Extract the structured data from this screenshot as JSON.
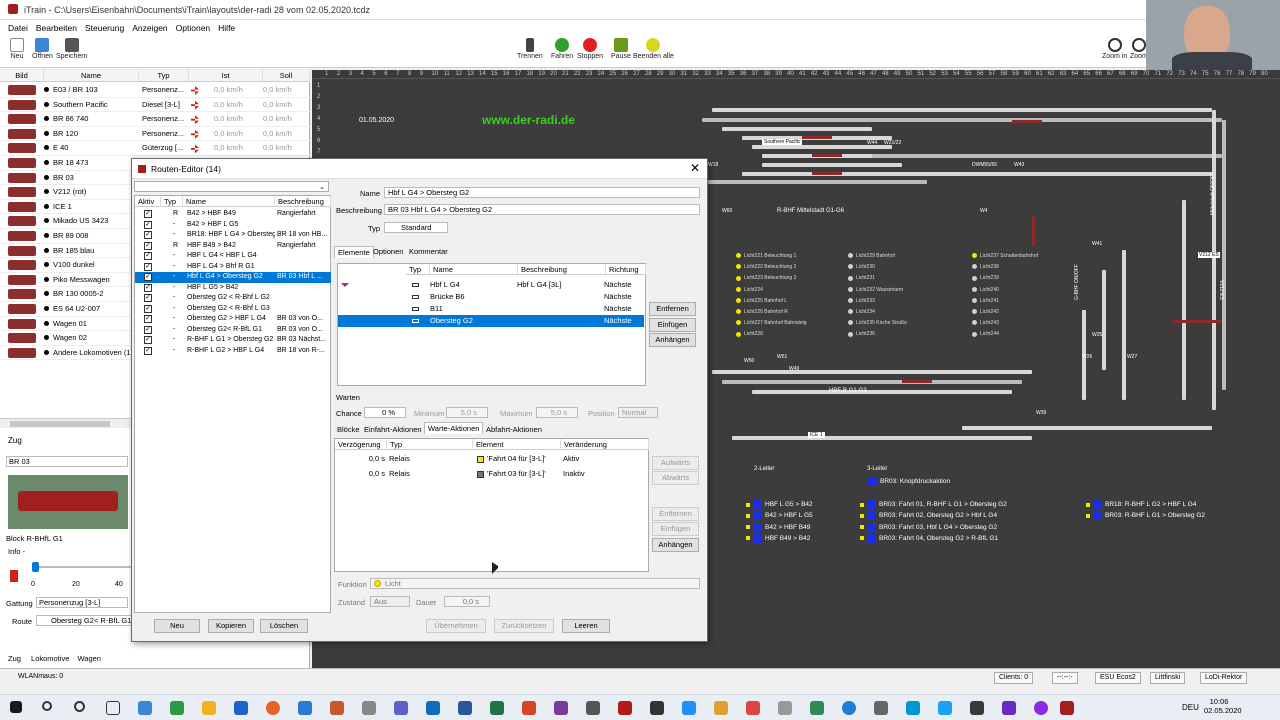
{
  "window": {
    "title": "iTrain - C:\\Users\\Eisenbahn\\Documents\\iTrain\\layouts\\der-radi 28 vom 02.05.2020.tcdz"
  },
  "menu": [
    "Datei",
    "Bearbeiten",
    "Steuerung",
    "Anzeigen",
    "Optionen",
    "Hilfe"
  ],
  "toolbar": {
    "new": "Neu",
    "open": "Öffnen",
    "save": "Speichern",
    "disconnect": "Trennen",
    "run": "Fahren",
    "stop": "Stoppen",
    "pause": "Pause",
    "quit_all": "Beenden alle",
    "zoom_in": "Zoom in",
    "zoom_out": "Zoom"
  },
  "loco_list": {
    "headers": [
      "Bild",
      "Name",
      "Typ",
      "Ist",
      "Soll"
    ],
    "rows": [
      {
        "name": "E03 / BR 103",
        "type": "Personenz...",
        "ist": "0,0 km/h",
        "soll": "0,0 km/h"
      },
      {
        "name": "Southern Pacific",
        "type": "Diesel [3-L]",
        "ist": "0,0 km/h",
        "soll": "0,0 km/h"
      },
      {
        "name": "BR 86 740",
        "type": "Personenz...",
        "ist": "0,0 km/h",
        "soll": "0,0 km/h"
      },
      {
        "name": "BR 120",
        "type": "Personenz...",
        "ist": "0,0 km/h",
        "soll": "0,0 km/h"
      },
      {
        "name": "E 40",
        "type": "Güterzug [...",
        "ist": "0,0 km/h",
        "soll": "0,0 km/h"
      },
      {
        "name": "BR 18 473",
        "type": "",
        "ist": "",
        "soll": ""
      },
      {
        "name": "BR 03",
        "type": "",
        "ist": "",
        "soll": ""
      },
      {
        "name": "V212 (rot)",
        "type": "",
        "ist": "",
        "soll": ""
      },
      {
        "name": "ICE 1",
        "type": "",
        "ist": "",
        "soll": ""
      },
      {
        "name": "Mikado US 3423",
        "type": "",
        "ist": "",
        "soll": ""
      },
      {
        "name": "BR 89 008",
        "type": "",
        "ist": "",
        "soll": ""
      },
      {
        "name": "BR 185 blau",
        "type": "",
        "ist": "",
        "soll": ""
      },
      {
        "name": "V100 dunkel",
        "type": "",
        "ist": "",
        "soll": ""
      },
      {
        "name": "Piko Messwagen",
        "type": "",
        "ist": "",
        "soll": ""
      },
      {
        "name": "BR 130 0005-2",
        "type": "",
        "ist": "",
        "soll": ""
      },
      {
        "name": "ES 64 U2-007",
        "type": "",
        "ist": "",
        "soll": ""
      },
      {
        "name": "Wagen 01",
        "type": "",
        "ist": "",
        "soll": ""
      },
      {
        "name": "Wagen 02",
        "type": "",
        "ist": "",
        "soll": ""
      },
      {
        "name": "Andere Lokomotiven (1)",
        "type": "",
        "ist": "",
        "soll": ""
      }
    ]
  },
  "zug": {
    "label": "Zug",
    "selected": "BR 03",
    "block_label": "Block",
    "block": "R-BHfL G1",
    "info_label": "Info",
    "info": "-",
    "scale": [
      "0",
      "20",
      "40"
    ],
    "speed_fraction": 0.0,
    "gattung_label": "Gattung",
    "gattung": "Personenzug [3-L]",
    "route_label": "Route",
    "route": "Obersteg G2< R-BfL G1"
  },
  "bottom_tabs": [
    "Zug",
    "Lokomotive",
    "Wagen"
  ],
  "wlan": "WLANmaus: 0",
  "dialog": {
    "title": "Routen-Editor (14)",
    "list_headers": [
      "Aktiv",
      "Typ",
      "Name",
      "Beschreibung"
    ],
    "routes": [
      {
        "type": "R",
        "name": "B42 > HBF B49",
        "desc": "Rangierfahrt",
        "sel": false
      },
      {
        "type": "-",
        "name": "B42 > HBF L G5",
        "desc": "",
        "sel": false
      },
      {
        "type": "-",
        "name": "BR18: HBF L G4 > Obersteg G2",
        "desc": "BR 18 von HB...",
        "sel": false
      },
      {
        "type": "R",
        "name": "HBF B49 > B42",
        "desc": "Rangierfahrt",
        "sel": false
      },
      {
        "type": "-",
        "name": "HBF L G4 < HBF L G4",
        "desc": "",
        "sel": false
      },
      {
        "type": "-",
        "name": "HBF L G4 > Bhf R G1",
        "desc": "",
        "sel": false
      },
      {
        "type": "-",
        "name": "Hbf L G4 > Obersteg G2",
        "desc": "BR 03 Hbf L ...",
        "sel": true
      },
      {
        "type": "-",
        "name": "HBF L G5 > B42",
        "desc": "",
        "sel": false
      },
      {
        "type": "-",
        "name": "Obersteg G2 < R-Bhf L G2",
        "desc": "",
        "sel": false
      },
      {
        "type": "-",
        "name": "Obersteg G2 < R-Bhf L G3",
        "desc": "",
        "sel": false
      },
      {
        "type": "-",
        "name": "Obersteg G2 > HBF L G4",
        "desc": "BR 03 von O...",
        "sel": false
      },
      {
        "type": "-",
        "name": "Obersteg G2< R-BfL G1",
        "desc": "BR 03 von O...",
        "sel": false
      },
      {
        "type": "-",
        "name": "R-BHF L G1 > Obersteg G2",
        "desc": "BR 03 Nächst...",
        "sel": false
      },
      {
        "type": "-",
        "name": "R-BHF L G2 > HBF L G4",
        "desc": "BR 18 von R-...",
        "sel": false
      }
    ],
    "name_label": "Name",
    "name": "Hbf L G4 > Obersteg G2",
    "desc_label": "Beschreibung",
    "desc": "BR 03 Hbf L G4 > Obersteg G2",
    "type_label": "Typ",
    "type": "Standard",
    "tabs": [
      "Elemente",
      "Optionen",
      "Kommentar"
    ],
    "elem_headers": [
      "Typ",
      "Name",
      "Beschreibung",
      "Richtung"
    ],
    "elements": [
      {
        "name": "Hbf L G4",
        "desc": "Hbf L G4 [3L]",
        "dir": "Nächste",
        "sel": false
      },
      {
        "name": "Brücke B6",
        "desc": "",
        "dir": "Nächste",
        "sel": false
      },
      {
        "name": "B11",
        "desc": "",
        "dir": "Nächste",
        "sel": false
      },
      {
        "name": "Obersteg G2",
        "desc": "",
        "dir": "Nächste",
        "sel": true
      }
    ],
    "elem_buttons": [
      "Entfernen",
      "Einfügen",
      "Anhängen"
    ],
    "warten_label": "Warten",
    "chance_label": "Chance",
    "chance": "0 %",
    "min_label": "Minimum",
    "min": "5,0 s",
    "max_label": "Maximum",
    "max": "5,0 s",
    "pos_label": "Position",
    "pos": "Normal",
    "action_tabs": [
      "Blöcke",
      "Einfahrt-Aktionen",
      "Warte-Aktionen",
      "Abfahrt-Aktionen"
    ],
    "action_headers": [
      "Verzögerung",
      "Typ",
      "Element",
      "Veränderung"
    ],
    "actions": [
      {
        "delay": "0,0 s",
        "type": "Relais",
        "element": "'Fahrt 04 für [3-L]'",
        "change": "Aktiv",
        "color": "#f5e51b"
      },
      {
        "delay": "0,0 s",
        "type": "Relais",
        "element": "'Fahrt 03 für [3-L]'",
        "change": "Inaktiv",
        "color": "#777777"
      }
    ],
    "action_buttons": [
      "Aufwärts",
      "Abwärts",
      "Entfernen",
      "Einfügen",
      "Anhängen"
    ],
    "function_label": "Funktion",
    "function": "Licht",
    "state_label": "Zustand",
    "state": "Aus",
    "duration_label": "Dauer",
    "duration": "0,0 s",
    "buttons": [
      "Übernehmen",
      "Zurücksetzen",
      "Leeren"
    ],
    "list_buttons": [
      "Neu",
      "Kopieren",
      "Löschen"
    ]
  },
  "layout": {
    "date": "01.05.2020",
    "url": "www.der-radi.de",
    "ruler": [
      "1",
      "2",
      "3",
      "4",
      "5",
      "6",
      "7",
      "8",
      "9",
      "10",
      "11",
      "12",
      "13",
      "14",
      "15",
      "16",
      "17",
      "18",
      "19",
      "20",
      "21",
      "22",
      "23",
      "24",
      "25",
      "26",
      "27",
      "28",
      "29",
      "30",
      "31",
      "32",
      "33",
      "34",
      "35",
      "36",
      "37",
      "38",
      "39",
      "40",
      "41",
      "42",
      "43",
      "44",
      "45",
      "46",
      "47",
      "48",
      "49",
      "50",
      "51",
      "52",
      "53",
      "54",
      "55",
      "56",
      "57",
      "58",
      "59",
      "60",
      "61",
      "62",
      "63",
      "64",
      "65",
      "66",
      "67",
      "68",
      "69",
      "70",
      "71",
      "72",
      "73",
      "74",
      "75",
      "76",
      "77",
      "78",
      "79",
      "80"
    ],
    "vruler": [
      "1",
      "2",
      "3",
      "4",
      "5",
      "6",
      "7"
    ],
    "labels": {
      "southern": "Southern Pacific",
      "w44": "W44",
      "w21": "W21/22",
      "w18": "W18",
      "dwm": "DWM55/56",
      "w43": "W43",
      "rbhf": "R-BHF Mittelstadt G1-G6",
      "w60": "W60",
      "w4": "W4",
      "w41": "W41",
      "w25": "W25",
      "w26": "W26",
      "w27": "W27",
      "w50": "W50",
      "w51": "W51",
      "w49": "W49",
      "hbf": "HBF R G1-G3",
      "w39": "W39",
      "ice": "ICE 1",
      "leiter2": "2-Leiter",
      "leiter3": "3-Leiter",
      "knopf": "BR03: Knopfdruckaktion",
      "v212": "V212 ES",
      "vright": "V212 ES",
      "vert1": "Mittelstadt ON/OFF",
      "vert2": "G-BHF ON/OFF"
    },
    "lamps_col1": [
      "Licht221 Beleuchtung 1",
      "Licht222 Beleuchtung 2",
      "Licht223 Beleuchtung 3",
      "Licht224",
      "Licht225 Bahnhof L",
      "Licht226 Bahnhof R",
      "Licht227 Bahnhof Bahnsteig",
      "Licht228"
    ],
    "lamps_col2": [
      "Licht229 Bahnhof",
      "Licht230",
      "Licht231",
      "Licht232 Wasserturm",
      "Licht233",
      "Licht234",
      "Licht235 Kirche Straße",
      "Licht236"
    ],
    "lamps_col3": [
      "Licht237 Schattenbahnhof",
      "Licht238",
      "Licht239",
      "Licht240",
      "Licht241",
      "Licht242",
      "Licht243",
      "Licht244"
    ],
    "routes_2l": [
      "HBF L G5 > B42",
      "B42 > HBF L G5",
      "B42 > HBF B49",
      "HBF B49 > B42"
    ],
    "routes_3l": [
      "BR03: Fahrt 01, R-BHF L G1 > Obersteg G2",
      "BR03: Fahrt 02, Obersteg G2 > Hbf L G4",
      "BR03: Fahrt 03, Hbf L G4 > Obersteg G2",
      "BR03: Fahrt 04, Obersteg G2 > R-BfL G1"
    ],
    "routes_br18": [
      "BR18: R-BHF L G2 > HBF L G4",
      "BR03: R-BHF L G1 > Obersteg G2"
    ]
  },
  "statusbar": {
    "clients": "Clients: 0",
    "dash": "--:--:-",
    "esu": "ESU Ecos2",
    "litt": "Littfinski",
    "lodi": "LoDi-Rektor"
  },
  "clock": {
    "time": "10:06",
    "date": "02.05.2020",
    "lang": "DEU"
  },
  "colors": {
    "selection": "#0078d7",
    "layout_bg": "#3c3c3c",
    "route_blue": "#1a2ee6",
    "lamp_yellow": "#f2e600",
    "track_red": "#8a2a2a"
  }
}
